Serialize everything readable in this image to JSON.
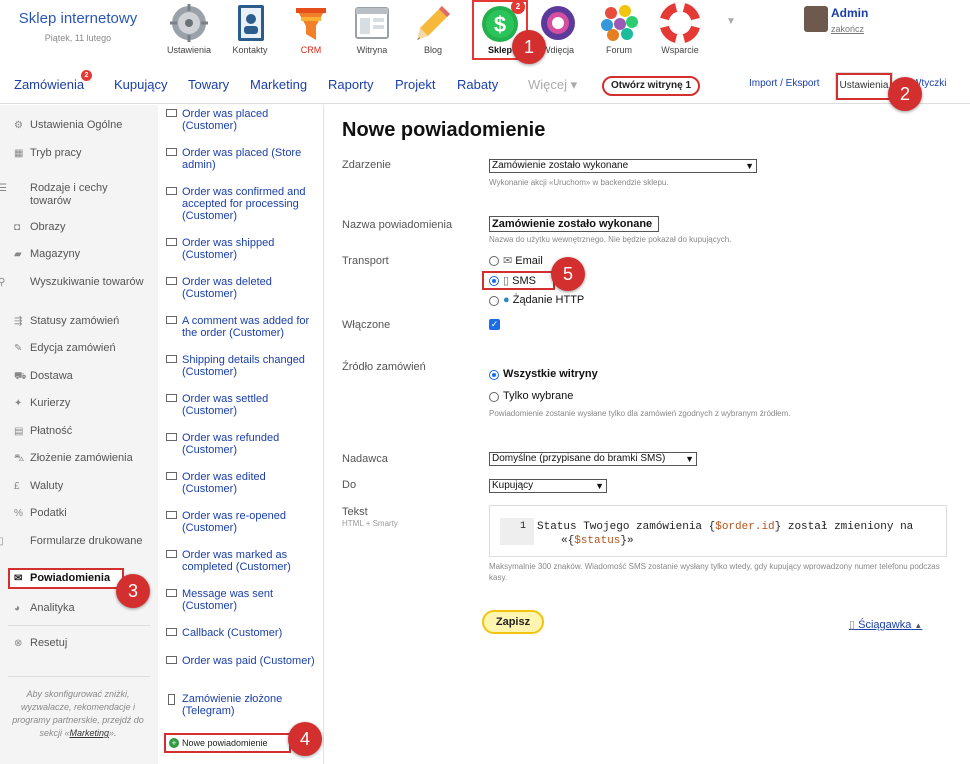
{
  "brand": {
    "title": "Sklep internetowy",
    "date": "Piątek, 11 lutego"
  },
  "apps": [
    {
      "label": "Ustawienia"
    },
    {
      "label": "Kontakty"
    },
    {
      "label": "CRM"
    },
    {
      "label": "Witryna"
    },
    {
      "label": "Blog"
    },
    {
      "label": "Sklep",
      "badge": "2"
    },
    {
      "label": "Wdięcja"
    },
    {
      "label": "Forum"
    },
    {
      "label": "Wsparcie"
    }
  ],
  "user": {
    "name": "Admin",
    "logout": "zakończ"
  },
  "nav": {
    "items": [
      "Zamówienia",
      "Kupujący",
      "Towary",
      "Marketing",
      "Raporty",
      "Projekt",
      "Rabaty",
      "Więcej ▾"
    ],
    "orders_badge": "2",
    "open_store": "Otwórz witrynę 1",
    "import_export": "Import / Eksport",
    "settings_tab": "Ustawienia",
    "plugins_tab": "Wtyczki"
  },
  "sidebar": {
    "items": [
      {
        "label": "Ustawienia Ogólne"
      },
      {
        "label": "Tryb pracy"
      },
      {
        "label": "Rodzaje i cechy towarów"
      },
      {
        "label": "Obrazy"
      },
      {
        "label": "Magazyny"
      },
      {
        "label": "Wyszukiwanie towarów"
      },
      {
        "label": "Statusy zamówień"
      },
      {
        "label": "Edycja zamówień"
      },
      {
        "label": "Dostawa"
      },
      {
        "label": "Kurierzy"
      },
      {
        "label": "Płatność"
      },
      {
        "label": "Złożenie zamówienia"
      },
      {
        "label": "Waluty"
      },
      {
        "label": "Podatki"
      },
      {
        "label": "Formularze drukowane"
      },
      {
        "label": "Powiadomienia"
      },
      {
        "label": "Analityka"
      },
      {
        "label": "Resetuj"
      }
    ],
    "note_pre": "Aby skonfigurować zniżki, wyzwalacze, rekomendacje i programy partnerskie, przejdź do sekcji «",
    "note_link": "Marketing",
    "note_post": "»."
  },
  "notifications": {
    "items": [
      {
        "label": "Order was placed (Customer)"
      },
      {
        "label": "Order was placed (Store admin)"
      },
      {
        "label": "Order was confirmed and accepted for processing (Customer)"
      },
      {
        "label": "Order was shipped (Customer)"
      },
      {
        "label": "Order was deleted (Customer)"
      },
      {
        "label": "A comment was added for the order (Customer)"
      },
      {
        "label": "Shipping details changed (Customer)"
      },
      {
        "label": "Order was settled (Customer)"
      },
      {
        "label": "Order was refunded (Customer)"
      },
      {
        "label": "Order was edited (Customer)"
      },
      {
        "label": "Order was re-opened (Customer)"
      },
      {
        "label": "Order was marked as completed (Customer)"
      },
      {
        "label": "Message was sent (Customer)"
      },
      {
        "label": "Callback (Customer)"
      },
      {
        "label": "Order was paid (Customer)"
      },
      {
        "label": "Zamówienie złożone (Telegram)"
      }
    ],
    "new_button": "Nowe powiadomienie"
  },
  "form": {
    "title": "Nowe powiadomienie",
    "event_label": "Zdarzenie",
    "event_value": "Zamówienie zostało wykonane",
    "event_hint": "Wykonanie akcji «Uruchom» w backendzie sklepu.",
    "name_label": "Nazwa powiadomienia",
    "name_value": "Zamówienie zostało wykonane",
    "name_hint": "Nazwa do użytku wewnętrznego. Nie będzie pokazał do kupujących.",
    "transport_label": "Transport",
    "transport_options": [
      "Email",
      "SMS",
      "Żądanie HTTP"
    ],
    "transport_selected": "SMS",
    "enabled_label": "Włączone",
    "enabled": true,
    "source_label": "Źródło zamówień",
    "source_options": [
      "Wszystkie witryny",
      "Tylko wybrane"
    ],
    "source_selected": "Wszystkie witryny",
    "source_hint": "Powiadomienie zostanie wysłane tylko dla zamówień zgodnych z wybranym źródłem.",
    "sender_label": "Nadawca",
    "sender_value": "Domyślne (przypisane do bramki SMS)",
    "to_label": "Do",
    "to_value": "Kupujący",
    "text_label": "Tekst",
    "text_sublabel": "HTML + Smarty",
    "code_line_no": "1",
    "code_part1": "Status Twojego zamówienia {",
    "code_var1": "$order.id",
    "code_part2": "} został zmieniony na",
    "code_part3": "«{",
    "code_var2": "$status",
    "code_part4": "}»",
    "text_hint": "Maksymalnie 300 znaków. Wiadomość SMS zostanie wysłany tylko wtedy, gdy kupujący wprowadzony numer telefonu podczas kasy.",
    "save_button": "Zapisz",
    "cheatsheet": "Ściągawka"
  },
  "callouts": [
    "1",
    "2",
    "3",
    "4",
    "5"
  ]
}
